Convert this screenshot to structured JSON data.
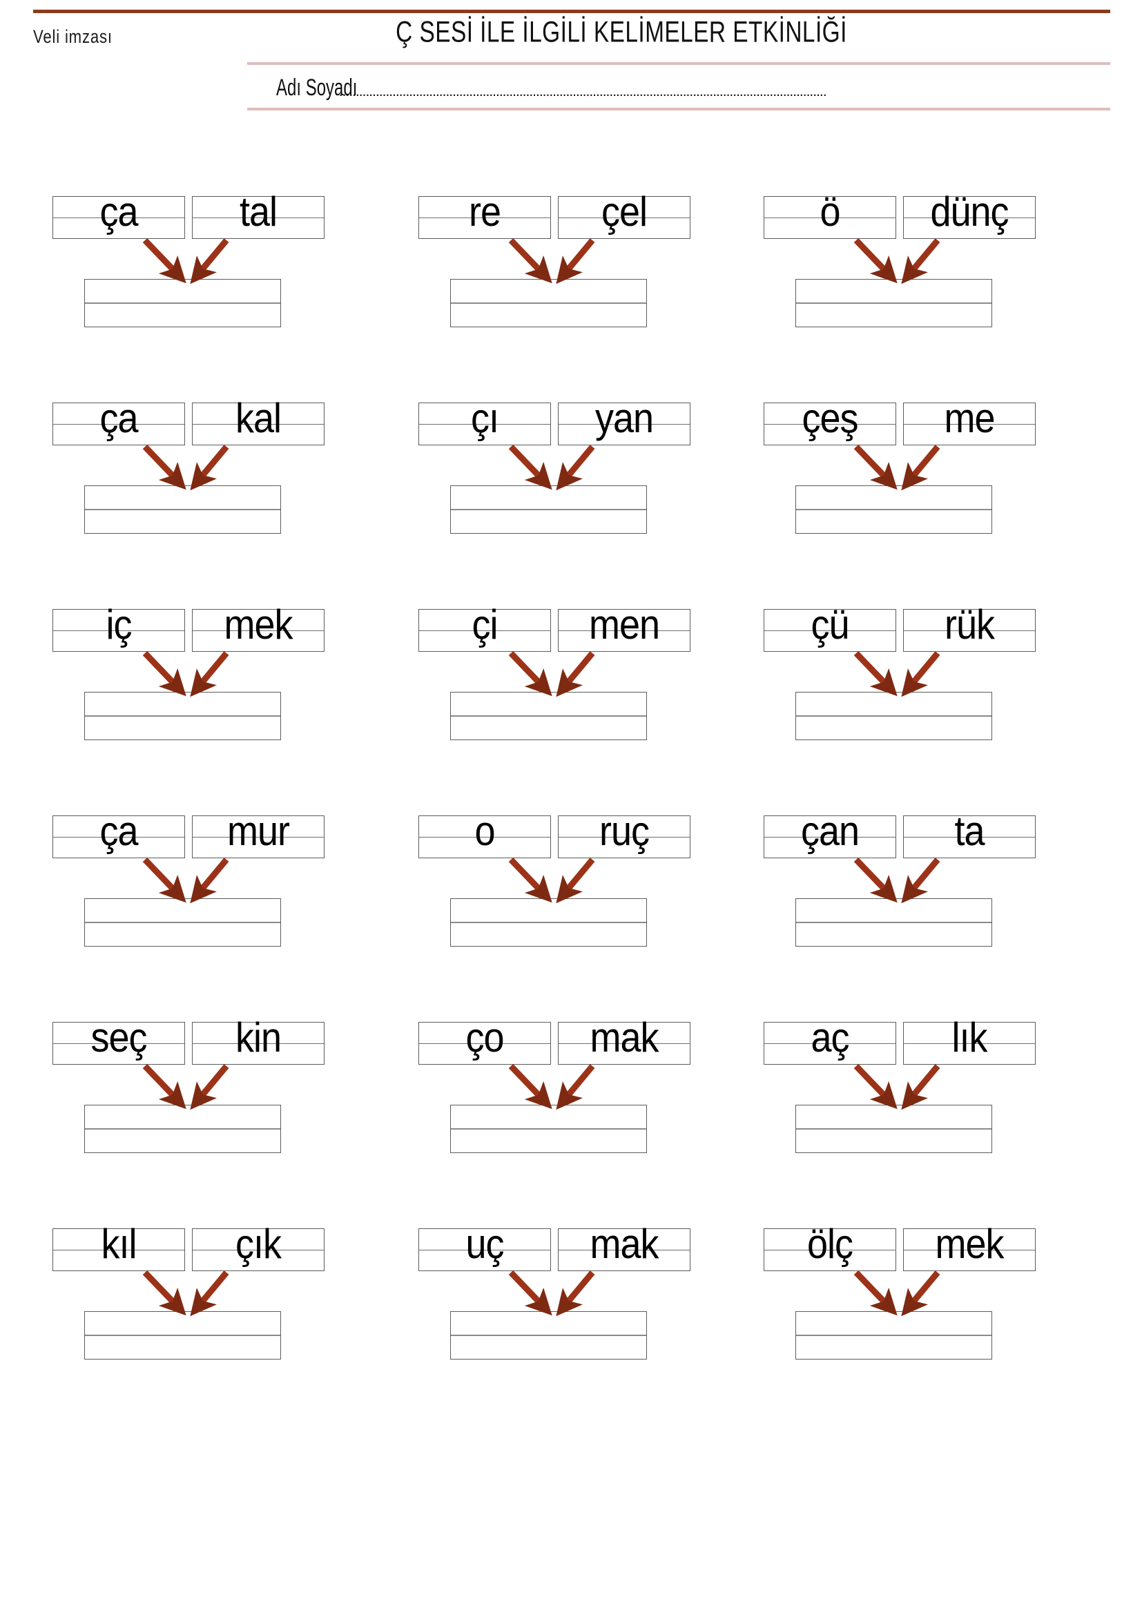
{
  "header": {
    "parent_signature_label": "Veli imzası",
    "title": "Ç SESİ İLE İLGİLİ KELİMELER ETKİNLİĞİ",
    "name_label": "Adı Soyadı",
    "name_dots": "..................................................................................................................................................",
    "rule_color": "#8b3a1c",
    "accent_line_color": "#dfbdbd"
  },
  "style": {
    "arrow_color": "#9c3318",
    "arrow_color_dark": "#7e2a12",
    "box_border_color": "#5c5c5c",
    "box_midline_color": "#6e6e6e"
  },
  "exercises": [
    [
      {
        "left": "ça",
        "right": "tal",
        "answer": ""
      },
      {
        "left": "re",
        "right": "çel",
        "answer": ""
      },
      {
        "left": "ö",
        "right": "dünç",
        "answer": ""
      }
    ],
    [
      {
        "left": "ça",
        "right": "kal",
        "answer": ""
      },
      {
        "left": "çı",
        "right": "yan",
        "answer": ""
      },
      {
        "left": "çeş",
        "right": "me",
        "answer": ""
      }
    ],
    [
      {
        "left": "iç",
        "right": "mek",
        "answer": ""
      },
      {
        "left": "çi",
        "right": "men",
        "answer": ""
      },
      {
        "left": "çü",
        "right": "rük",
        "answer": ""
      }
    ],
    [
      {
        "left": "ça",
        "right": "mur",
        "answer": ""
      },
      {
        "left": "o",
        "right": "ruç",
        "answer": ""
      },
      {
        "left": "çan",
        "right": "ta",
        "answer": ""
      }
    ],
    [
      {
        "left": "seç",
        "right": "kin",
        "answer": ""
      },
      {
        "left": "ço",
        "right": "mak",
        "answer": ""
      },
      {
        "left": "aç",
        "right": "lık",
        "answer": ""
      }
    ],
    [
      {
        "left": "kıl",
        "right": "çık",
        "answer": ""
      },
      {
        "left": "uç",
        "right": "mak",
        "answer": ""
      },
      {
        "left": "ölç",
        "right": "mek",
        "answer": ""
      }
    ]
  ]
}
